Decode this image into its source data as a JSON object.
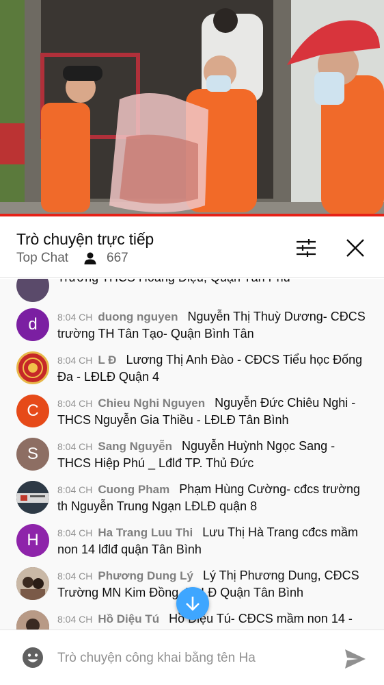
{
  "chat": {
    "title": "Trò chuyện trực tiếp",
    "mode": "Top Chat",
    "viewer_count": "667",
    "icons": {
      "filter": "tune-icon",
      "close": "close-icon",
      "viewers": "person-icon",
      "emoji": "emoji-icon",
      "send": "send-icon",
      "scroll": "arrow-down-icon"
    }
  },
  "messages": [
    {
      "time": "",
      "author": "",
      "text": "Trường THCS Hoàng Diệu, Quận Tân Phú",
      "avatar_letter": "",
      "avatar_color": "#5a4a6a"
    },
    {
      "time": "8:04 CH",
      "author": "duong nguyen",
      "text": "Nguyễn Thị Thuỳ Dương- CĐCS trường TH Tân Tạo- Quận Bình Tân",
      "avatar_letter": "d",
      "avatar_color": "#7b1fa2"
    },
    {
      "time": "8:04 CH",
      "author": "L Đ",
      "text": "Lương Thị Anh Đào - CĐCS Tiểu học Đống Đa - LĐLĐ Quận 4",
      "avatar_letter": "",
      "avatar_color": "#c62828"
    },
    {
      "time": "8:04 CH",
      "author": "Chieu Nghi Nguyen",
      "text": "Nguyễn Đức Chiêu Nghi - THCS Nguyễn Gia Thiều - LĐLĐ Tân Bình",
      "avatar_letter": "C",
      "avatar_color": "#e64a19"
    },
    {
      "time": "8:04 CH",
      "author": "Sang Nguyễn",
      "text": "Nguyễn Huỳnh Ngọc Sang - THCS Hiệp Phú _ Lđlđ TP. Thủ Đức",
      "avatar_letter": "S",
      "avatar_color": "#8d6e63"
    },
    {
      "time": "8:04 CH",
      "author": "Cuong Pham",
      "text": "Phạm Hùng Cường- cđcs trường th Nguyễn Trung Ngạn LĐLĐ quận 8",
      "avatar_letter": "",
      "avatar_color": "#37474f"
    },
    {
      "time": "8:04 CH",
      "author": "Ha Trang Luu Thi",
      "text": "Lưu Thị Hà Trang cđcs mầm non 14 lđlđ quận Tân Bình",
      "avatar_letter": "H",
      "avatar_color": "#8e24aa"
    },
    {
      "time": "8:04 CH",
      "author": "Phương Dung Lý",
      "text": "Lý Thị Phương Dung, CĐCS Trường MN Kim Đồng, LĐLĐ Quận Tân Bình",
      "avatar_letter": "",
      "avatar_color": "#6d4c41"
    },
    {
      "time": "8:04 CH",
      "author": "Hồ Diệu Tú",
      "text": "Hồ Diệu Tú- CĐCS mầm non 14 -",
      "avatar_letter": "",
      "avatar_color": "#5d4037"
    }
  ],
  "input": {
    "placeholder": "Trò chuyện công khai bằng tên Ha"
  }
}
